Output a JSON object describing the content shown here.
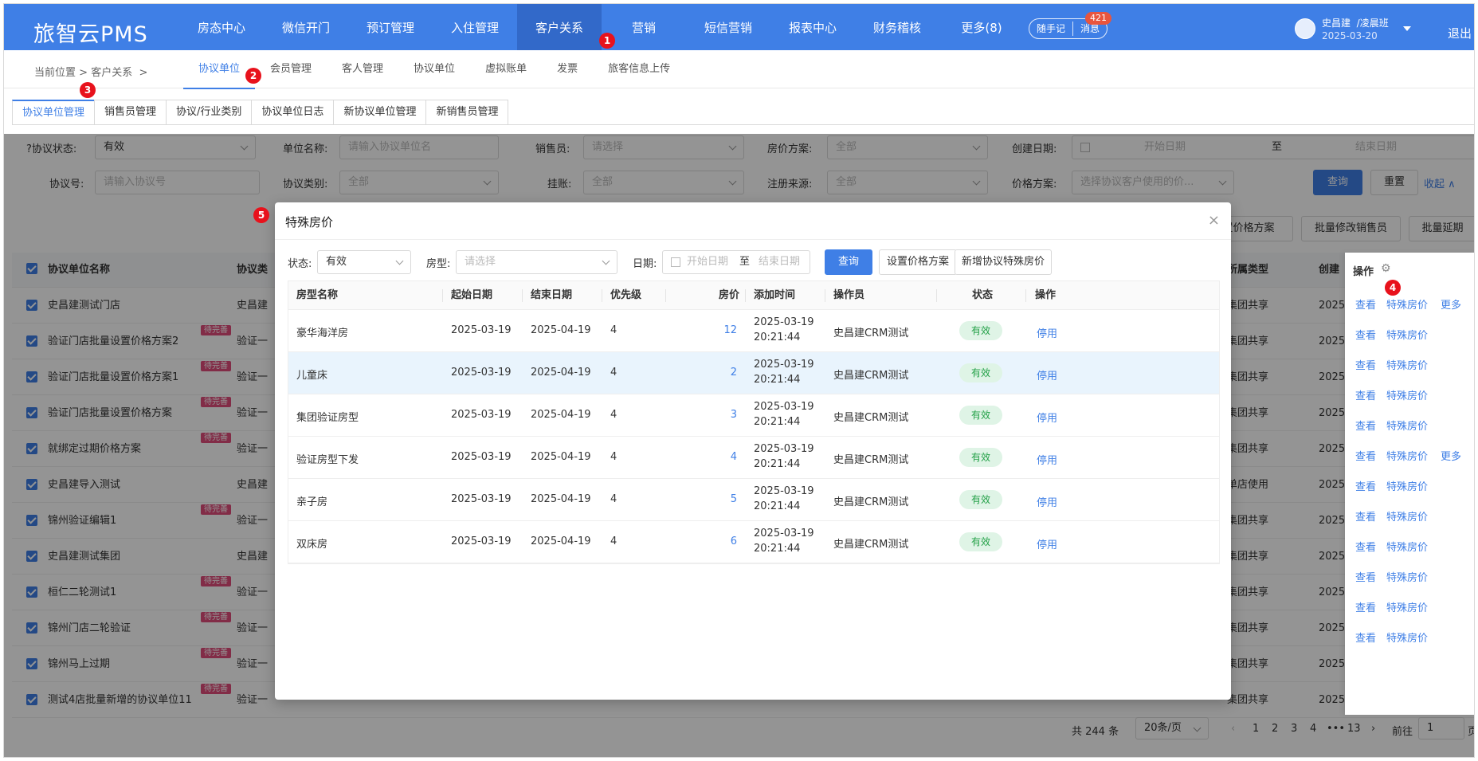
{
  "topbar": {
    "logo": "旅智云PMS",
    "nav": [
      "房态中心",
      "微信开门",
      "预订管理",
      "入住管理",
      "客户关系",
      "营销",
      "短信营销",
      "报表中心",
      "财务稽核",
      "更多(8)"
    ],
    "notes": "随手记",
    "messages": "消息",
    "message_count": "421",
    "user": "史昌建",
    "shift": "/凌晨班",
    "date": "2025-03-20",
    "logout": "退出"
  },
  "markers": [
    "1",
    "2",
    "3",
    "4",
    "5"
  ],
  "breadcrumb": {
    "label": "当前位置",
    "sep": ">",
    "section": "客户关系",
    "sep2": ">"
  },
  "subnav": [
    "协议单位",
    "会员管理",
    "客人管理",
    "协议单位",
    "虚拟账单",
    "发票",
    "旅客信息上传"
  ],
  "tabs": [
    "协议单位管理",
    "销售员管理",
    "协议/行业类别",
    "协议单位日志",
    "新协议单位管理",
    "新销售员管理"
  ],
  "filters": {
    "status_label": "协议状态:",
    "status_value": "有效",
    "unit_name_label": "单位名称:",
    "unit_name_ph": "请输入协议单位名",
    "sales_label": "销售员:",
    "sales_ph": "请选择",
    "room_plan_label": "房价方案:",
    "room_plan_value": "全部",
    "create_date_label": "创建日期:",
    "start_ph": "开始日期",
    "to": "至",
    "end_ph": "结束日期",
    "agreement_no_label": "协议号:",
    "agreement_no_ph": "请输入协议号",
    "category_label": "协议类别:",
    "category_value": "全部",
    "ledger_label": "挂账:",
    "ledger_value": "全部",
    "source_label": "注册来源:",
    "source_value": "全部",
    "price_plan_label": "价格方案:",
    "price_plan_ph": "选择协议客户使用的价...",
    "query": "查询",
    "reset": "重置",
    "collapse": "收起 ∧"
  },
  "batch": {
    "price_plan": "设置价格方案",
    "sales": "批量修改销售员",
    "extend": "批量延期"
  },
  "main_table": {
    "headers": {
      "name": "协议单位名称",
      "type": "协议类",
      "belong": "所属类型",
      "create": "创建",
      "op": "操作"
    },
    "rows": [
      {
        "name": "史昌建测试门店",
        "type": "史昌建",
        "tag": "",
        "belong": "集团共享",
        "create": "2025",
        "more": "更多"
      },
      {
        "name": "验证门店批量设置价格方案2",
        "type": "验证一",
        "tag": "待完善",
        "belong": "集团共享",
        "create": "2025",
        "more": ""
      },
      {
        "name": "验证门店批量设置价格方案1",
        "type": "验证一",
        "tag": "待完善",
        "belong": "集团共享",
        "create": "2025",
        "more": ""
      },
      {
        "name": "验证门店批量设置价格方案",
        "type": "验证一",
        "tag": "待完善",
        "belong": "集团共享",
        "create": "2025",
        "more": ""
      },
      {
        "name": "就绑定过期价格方案",
        "type": "验证一",
        "tag": "待完善",
        "belong": "集团共享",
        "create": "2025",
        "more": ""
      },
      {
        "name": "史昌建导入测试",
        "type": "史昌建",
        "tag": "",
        "belong": "单店使用",
        "create": "2025",
        "more": "更多"
      },
      {
        "name": "锦州验证编辑1",
        "type": "验证一",
        "tag": "待完善",
        "belong": "集团共享",
        "create": "2025",
        "more": ""
      },
      {
        "name": "史昌建测试集团",
        "type": "史昌建",
        "tag": "",
        "belong": "集团共享",
        "create": "2025",
        "more": ""
      },
      {
        "name": "桓仁二轮测试1",
        "type": "验证一",
        "tag": "待完善",
        "belong": "集团共享",
        "create": "2025",
        "more": ""
      },
      {
        "name": "锦州门店二轮验证",
        "type": "验证一",
        "tag": "待完善",
        "belong": "集团共享",
        "create": "2025",
        "more": ""
      },
      {
        "name": "锦州马上过期",
        "type": "验证一",
        "tag": "待完善",
        "belong": "集团共享",
        "create": "2025",
        "more": ""
      },
      {
        "name": "测试4店批量新增的协议单位11",
        "type": "验证一",
        "tag": "待完善",
        "belong": "集团共享",
        "create": "2025",
        "more": ""
      }
    ],
    "view": "查看",
    "special": "特殊房价"
  },
  "pager": {
    "total": "共 244 条",
    "size": "20条/页",
    "pages": [
      "1",
      "2",
      "3",
      "4",
      "•••",
      "13"
    ],
    "goto": "前往",
    "goto_value": "1",
    "page": "页"
  },
  "modal": {
    "title": "特殊房价",
    "close": "×",
    "status_label": "状态:",
    "status_value": "有效",
    "roomtype_label": "房型:",
    "roomtype_ph": "请选择",
    "date_label": "日期:",
    "start_ph": "开始日期",
    "to": "至",
    "end_ph": "结束日期",
    "query": "查询",
    "set_plan": "设置价格方案",
    "add": "新增协议特殊房价",
    "headers": [
      "房型名称",
      "起始日期",
      "结束日期",
      "优先级",
      "房价",
      "添加时间",
      "操作员",
      "状态",
      "操作"
    ],
    "rows": [
      {
        "room": "豪华海洋房",
        "start": "2025-03-19",
        "end": "2025-04-19",
        "prio": "4",
        "price": "12",
        "date": "2025-03-19",
        "time": "20:21:44",
        "op": "史昌建CRM测试",
        "status": "有效",
        "action": "停用"
      },
      {
        "room": "儿童床",
        "start": "2025-03-19",
        "end": "2025-04-19",
        "prio": "4",
        "price": "2",
        "date": "2025-03-19",
        "time": "20:21:44",
        "op": "史昌建CRM测试",
        "status": "有效",
        "action": "停用"
      },
      {
        "room": "集团验证房型",
        "start": "2025-03-19",
        "end": "2025-04-19",
        "prio": "4",
        "price": "3",
        "date": "2025-03-19",
        "time": "20:21:44",
        "op": "史昌建CRM测试",
        "status": "有效",
        "action": "停用"
      },
      {
        "room": "验证房型下发",
        "start": "2025-03-19",
        "end": "2025-04-19",
        "prio": "4",
        "price": "4",
        "date": "2025-03-19",
        "time": "20:21:44",
        "op": "史昌建CRM测试",
        "status": "有效",
        "action": "停用"
      },
      {
        "room": "亲子房",
        "start": "2025-03-19",
        "end": "2025-04-19",
        "prio": "4",
        "price": "5",
        "date": "2025-03-19",
        "time": "20:21:44",
        "op": "史昌建CRM测试",
        "status": "有效",
        "action": "停用"
      },
      {
        "room": "双床房",
        "start": "2025-03-19",
        "end": "2025-04-19",
        "prio": "4",
        "price": "6",
        "date": "2025-03-19",
        "time": "20:21:44",
        "op": "史昌建CRM测试",
        "status": "有效",
        "action": "停用"
      }
    ]
  },
  "colors": {
    "accent": "#3f7fe6",
    "marker": "#e8121c",
    "status_bg": "#dff4e6",
    "status_text": "#24a148"
  }
}
